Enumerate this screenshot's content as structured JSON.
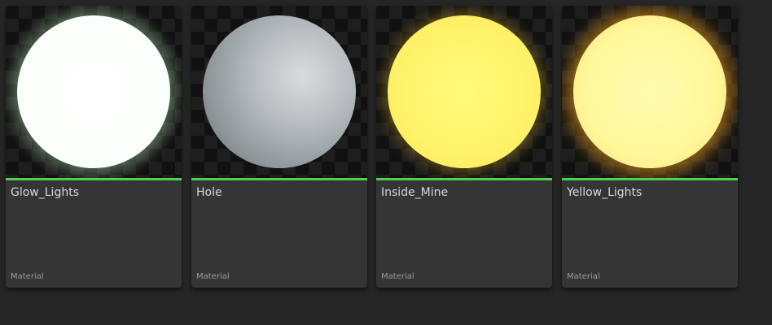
{
  "assets": [
    {
      "name": "Glow_Lights",
      "type": "Material",
      "type_color": "#4cd34c"
    },
    {
      "name": "Hole",
      "type": "Material",
      "type_color": "#4cd34c"
    },
    {
      "name": "Inside_Mine",
      "type": "Material",
      "type_color": "#4cd34c"
    },
    {
      "name": "Yellow_Lights",
      "type": "Material",
      "type_color": "#4cd34c"
    }
  ],
  "colors": {
    "background": "#262626",
    "tile": "#353535",
    "material_accent": "#4cd34c"
  }
}
